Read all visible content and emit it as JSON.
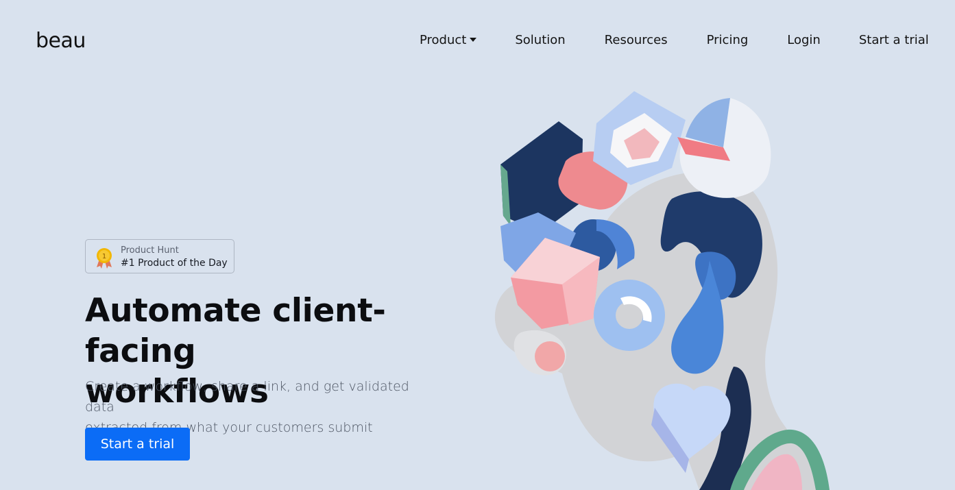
{
  "brand": {
    "logo_text": "beau"
  },
  "nav": {
    "items": [
      {
        "label": "Product",
        "has_dropdown": true
      },
      {
        "label": "Solution"
      },
      {
        "label": "Resources"
      },
      {
        "label": "Pricing"
      },
      {
        "label": "Login"
      },
      {
        "label": "Start a trial"
      }
    ]
  },
  "badge": {
    "source": "Product Hunt",
    "award": "#1 Product of the Day",
    "medal_number": "1",
    "icon": "medal-icon"
  },
  "hero": {
    "headline_line1": "Automate client-facing",
    "headline_line2": "workflows",
    "subtext_line1": "Create a workflow, share a link, and get validated data",
    "subtext_line2": "extracted from what your customers submit",
    "cta_label": "Start a trial"
  },
  "colors": {
    "background": "#d9e2ee",
    "primary": "#0b6cf6",
    "text": "#0c0d10",
    "muted": "#4e5664"
  }
}
